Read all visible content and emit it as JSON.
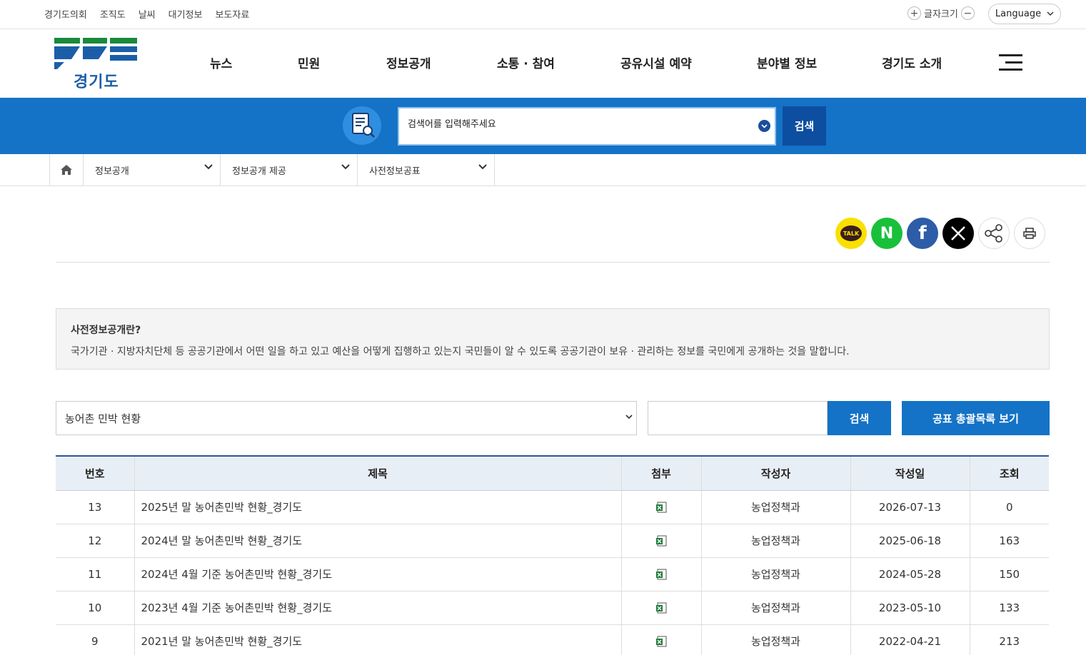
{
  "util": {
    "links": [
      "경기도의회",
      "조직도",
      "날씨",
      "대기정보",
      "보도자료"
    ],
    "font_size_label": "글자크기",
    "font_plus": "+",
    "font_minus": "−",
    "language": "Language"
  },
  "header": {
    "logo_text": "경기도",
    "nav": [
      "뉴스",
      "민원",
      "정보공개",
      "소통 · 참여",
      "공유시설 예약",
      "분야별 정보",
      "경기도 소개"
    ]
  },
  "search": {
    "placeholder": "검색어를 입력해주세요",
    "button": "검색"
  },
  "breadcrumb": {
    "items": [
      "정보공개",
      "정보공개 제공",
      "사전정보공표"
    ]
  },
  "share": {
    "kakao_label": "TALK",
    "naver_label": "N",
    "facebook_label": "f"
  },
  "info": {
    "title": "사전정보공개란?",
    "description": "국가기관 · 지방자치단체 등 공공기관에서 어떤 일을 하고 있고 예산을 어떻게 집행하고 있는지 국민들이 알 수 있도록 공공기관이 보유 · 관리하는 정보를 국민에게 공개하는 것을 말합니다."
  },
  "filter": {
    "selected": "농어촌 민박 현황",
    "search_button": "검색",
    "list_button": "공표 총괄목록 보기"
  },
  "table": {
    "headers": [
      "번호",
      "제목",
      "첨부",
      "작성자",
      "작성일",
      "조회"
    ],
    "rows": [
      {
        "no": "13",
        "title": "2025년 말 농어촌민박 현황_경기도",
        "author": "농업정책과",
        "date": "2026-07-13",
        "views": "0"
      },
      {
        "no": "12",
        "title": "2024년 말 농어촌민박 현황_경기도",
        "author": "농업정책과",
        "date": "2025-06-18",
        "views": "163"
      },
      {
        "no": "11",
        "title": "2024년 4월 기준 농어촌민박 현황_경기도",
        "author": "농업정책과",
        "date": "2024-05-28",
        "views": "150"
      },
      {
        "no": "10",
        "title": "2023년 4월 기준 농어촌민박 현황_경기도",
        "author": "농업정책과",
        "date": "2023-05-10",
        "views": "133"
      },
      {
        "no": "9",
        "title": "2021년 말 농어촌민박 현황_경기도",
        "author": "농업정책과",
        "date": "2022-04-21",
        "views": "213"
      }
    ]
  },
  "colors": {
    "primary_blue": "#1473c6",
    "dark_blue": "#0d4ea1",
    "logo_green": "#1a8a3c",
    "logo_blue": "#1b5ea8"
  }
}
